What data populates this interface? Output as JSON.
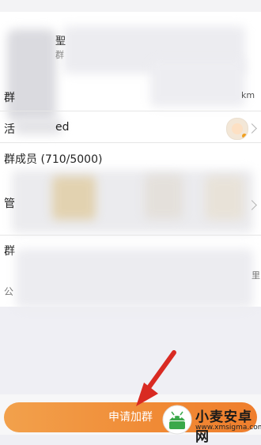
{
  "header": {
    "char1": "聖",
    "char2": "群"
  },
  "group": {
    "distance_suffix": "km",
    "creator_partial": "ed",
    "members_label": "群成员 (710/5000)",
    "intro_char1": "群",
    "intro_char2": "公",
    "right_char": "里"
  },
  "left_chars": [
    "群",
    "活",
    "管"
  ],
  "action": {
    "apply_label": "申请加群"
  },
  "watermark": {
    "title": "小麦安卓网",
    "url": "www.xmsigma.com"
  },
  "colors": {
    "accent_orange": "#f08a35",
    "arrow_red": "#d92a22",
    "logo_green": "#3aa84a"
  }
}
